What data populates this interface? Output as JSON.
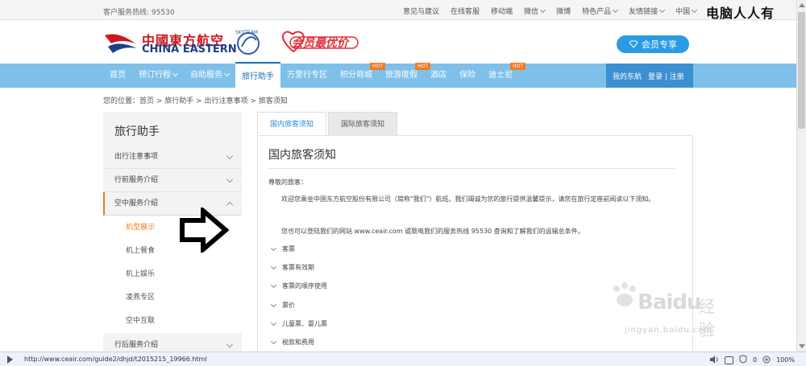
{
  "top_bar": {
    "hotline_label": "客户服务热线:",
    "hotline_number": "95530",
    "links": [
      {
        "label": "意见与建议",
        "dropdown": false
      },
      {
        "label": "在线客服",
        "dropdown": false
      },
      {
        "label": "移动端",
        "dropdown": false
      },
      {
        "label": "微信",
        "dropdown": true
      },
      {
        "label": "微博",
        "dropdown": false
      },
      {
        "label": "特色产品",
        "dropdown": true
      },
      {
        "label": "友情链接",
        "dropdown": true
      },
      {
        "label": "中国",
        "dropdown": true
      }
    ],
    "corner_brand": "电脑人人有"
  },
  "header": {
    "logo_cn": "中國東方航空",
    "logo_en": "CHINA EASTERN",
    "skyteam": "SKYTEAM",
    "promo_text": "会员最优价",
    "member_button": "会员专享"
  },
  "nav": {
    "items": [
      {
        "label": "首页",
        "hot": false,
        "dropdown": false,
        "active": false
      },
      {
        "label": "预订行程",
        "hot": false,
        "dropdown": true,
        "active": false
      },
      {
        "label": "自助服务",
        "hot": false,
        "dropdown": true,
        "active": false
      },
      {
        "label": "旅行助手",
        "hot": false,
        "dropdown": false,
        "active": true
      },
      {
        "label": "万里行专区",
        "hot": false,
        "dropdown": false,
        "active": false
      },
      {
        "label": "积分商城",
        "hot": true,
        "dropdown": false,
        "active": false
      },
      {
        "label": "旅游度假",
        "hot": true,
        "dropdown": false,
        "active": false
      },
      {
        "label": "酒店",
        "hot": false,
        "dropdown": false,
        "active": false
      },
      {
        "label": "保险",
        "hot": false,
        "dropdown": false,
        "active": false
      },
      {
        "label": "迪士尼",
        "hot": true,
        "dropdown": false,
        "active": false
      }
    ],
    "hot_label": "HOT",
    "my_account": "我的东航",
    "login_register": "登录 | 注册"
  },
  "breadcrumb": "您的位置：首页 > 旅行助手 > 出行注意事项 > 旅客须知",
  "sidebar": {
    "title": "旅行助手",
    "items": [
      {
        "label": "出行注意事项",
        "open": false
      },
      {
        "label": "行前服务介绍",
        "open": false
      },
      {
        "label": "空中服务介绍",
        "open": true
      }
    ],
    "subitems": [
      {
        "label": "机型展示",
        "current": true
      },
      {
        "label": "机上餐食",
        "current": false
      },
      {
        "label": "机上娱乐",
        "current": false
      },
      {
        "label": "凌燕专区",
        "current": false
      },
      {
        "label": "空中互联",
        "current": false
      }
    ],
    "after_item": "行后服务介绍"
  },
  "tabs": [
    {
      "label": "国内旅客须知",
      "active": true
    },
    {
      "label": "国际旅客须知",
      "active": false
    }
  ],
  "content": {
    "title": "国内旅客须知",
    "greeting": "尊敬的旅客：",
    "para1": "欢迎您乘坐中国东方航空股份有限公司（简称\"我们\"）航班。我们竭诚为您的旅行提供温馨提示，请您在旅行定座前阅读以下须知。",
    "para2": "您也可以登陆我们的网站 www.ceair.com 或致电我们的服务热线 95530 查询和了解我们的运输总条件。",
    "sections": [
      "客票",
      "客票有效期",
      "客票的顺序使用",
      "票价",
      "儿童票、婴儿票",
      "税款和费用"
    ]
  },
  "statusbar": {
    "url": "http://www.ceair.com/guide2/dhjd/t2015215_19966.html",
    "counter": "0",
    "zoom": "100%"
  },
  "watermark": {
    "brand": "Baidu",
    "cn": "经验",
    "url": "jingyan.baidu.com"
  },
  "colors": {
    "nav_bg": "#7ec0ea",
    "nav_active": "#1a6fb5",
    "accent_orange": "#f07b23",
    "brand_red": "#d0161e",
    "brand_blue": "#1d3f84"
  }
}
